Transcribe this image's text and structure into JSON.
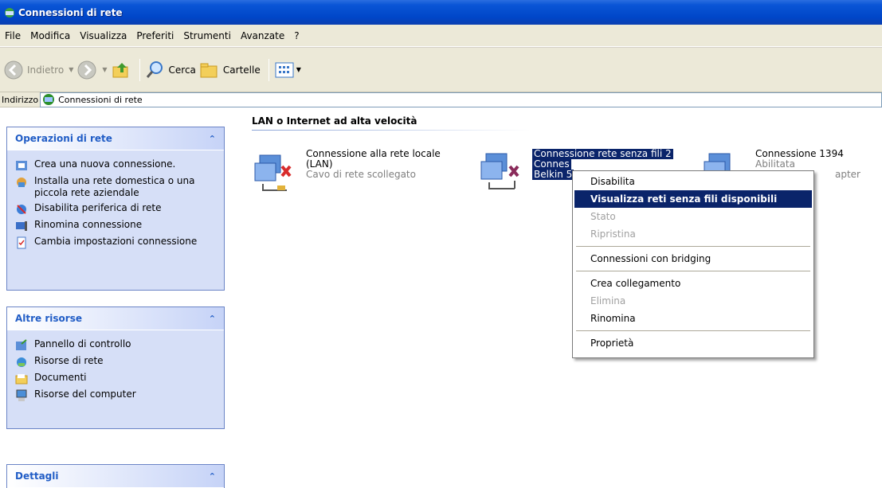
{
  "window": {
    "title": "Connessioni di rete"
  },
  "menu": [
    "File",
    "Modifica",
    "Visualizza",
    "Preferiti",
    "Strumenti",
    "Avanzate",
    "?"
  ],
  "toolbar": {
    "back": "Indietro",
    "search": "Cerca",
    "folders": "Cartelle"
  },
  "address": {
    "label": "Indirizzo",
    "value": "Connessioni di rete"
  },
  "tasks": {
    "network": {
      "title": "Operazioni di rete",
      "items": [
        "Crea una nuova connessione.",
        "Installa una rete domestica o una piccola rete aziendale",
        "Disabilita periferica di rete",
        "Rinomina connessione",
        "Cambia impostazioni connessione"
      ]
    },
    "other": {
      "title": "Altre risorse",
      "items": [
        "Pannello di controllo",
        "Risorse di rete",
        "Documenti",
        "Risorse del computer"
      ]
    },
    "details": {
      "title": "Dettagli"
    }
  },
  "content": {
    "group_title": "LAN o Internet ad alta velocità",
    "connections": [
      {
        "name": "Connessione alla rete locale",
        "name2": "(LAN)",
        "status": "Cavo di rete scollegato"
      },
      {
        "name": "Connessione rete senza fili 2",
        "name2": "Connes",
        "status": "Belkin 5"
      },
      {
        "name": "Connessione 1394",
        "status": "Abilitata",
        "status2": "apter"
      }
    ]
  },
  "context_menu": {
    "disable": "Disabilita",
    "view_wireless": "Visualizza reti senza fili disponibili",
    "status": "Stato",
    "repair": "Ripristina",
    "bridge": "Connessioni con bridging",
    "create_shortcut": "Crea collegamento",
    "delete": "Elimina",
    "rename": "Rinomina",
    "properties": "Proprietà"
  },
  "colors": {
    "title_bar": "#0046c8",
    "selection": "#0a246a",
    "task_pane_link": "#215dc6"
  }
}
